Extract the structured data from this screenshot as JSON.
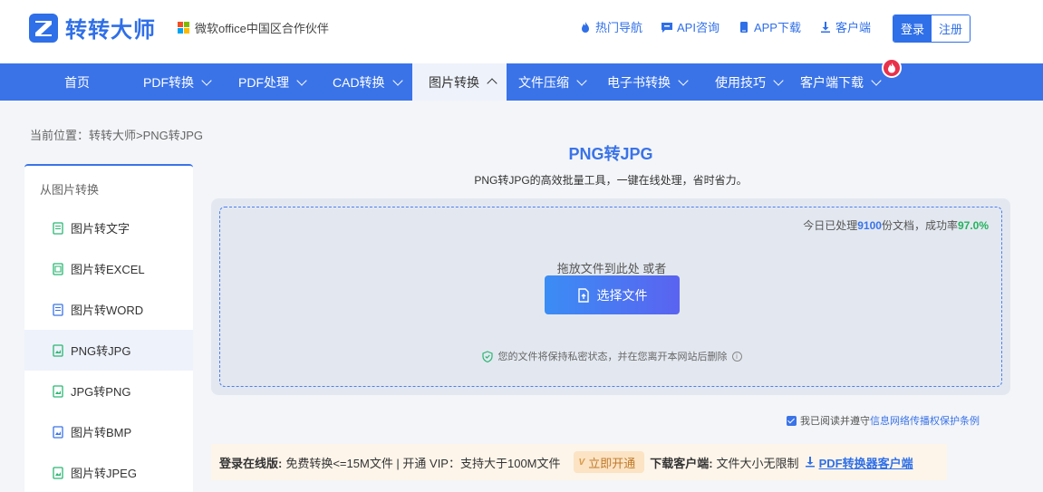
{
  "header": {
    "logo_text": "转转大师",
    "partner_text": "微软office中国区合作伙伴",
    "links": [
      {
        "label": "热门导航",
        "icon": "flame-icon"
      },
      {
        "label": "API咨询",
        "icon": "chat-icon"
      },
      {
        "label": "APP下载",
        "icon": "phone-icon"
      },
      {
        "label": "客户端",
        "icon": "download-icon"
      }
    ],
    "login_label": "登录",
    "register_label": "注册"
  },
  "nav": {
    "items": [
      {
        "label": "首页"
      },
      {
        "label": "PDF转换"
      },
      {
        "label": "PDF处理"
      },
      {
        "label": "CAD转换"
      },
      {
        "label": "图片转换"
      },
      {
        "label": "文件压缩"
      },
      {
        "label": "电子书转换"
      },
      {
        "label": "使用技巧"
      },
      {
        "label": "客户端下载"
      }
    ],
    "active_index": 4
  },
  "breadcrumb": "当前位置：转转大师>PNG转JPG",
  "sidebar": {
    "title": "从图片转换",
    "items": [
      {
        "label": "图片转文字"
      },
      {
        "label": "图片转EXCEL"
      },
      {
        "label": "图片转WORD"
      },
      {
        "label": "PNG转JPG"
      },
      {
        "label": "JPG转PNG"
      },
      {
        "label": "图片转BMP"
      },
      {
        "label": "图片转JPEG"
      }
    ],
    "active_index": 3
  },
  "main": {
    "title": "PNG转JPG",
    "subtitle": "PNG转JPG的高效批量工具，一键在线处理，省时省力。",
    "stat_prefix": "今日已处理",
    "stat_count": "9100",
    "stat_mid": "份文档，成功率",
    "stat_rate": "97.0%",
    "drop_text": "拖放文件到此处 或者",
    "choose_label": "选择文件",
    "privacy_text": "您的文件将保持私密状态，并在您离开本网站后删除",
    "agree_prefix": "我已阅读并遵守",
    "agree_link": "信息网络传播权保护条例"
  },
  "promo": {
    "online_label": "登录在线版:",
    "online_text": "免费转换<=15M文件 | 开通 VIP：支持大于100M文件",
    "vip_label": "立即开通",
    "client_label": "下载客户端:",
    "client_text": "文件大小无限制",
    "client_link": "PDF转换器客户端"
  },
  "colors": {
    "brand": "#3a73e8",
    "success": "#23b35e",
    "hot": "#e8314a"
  }
}
